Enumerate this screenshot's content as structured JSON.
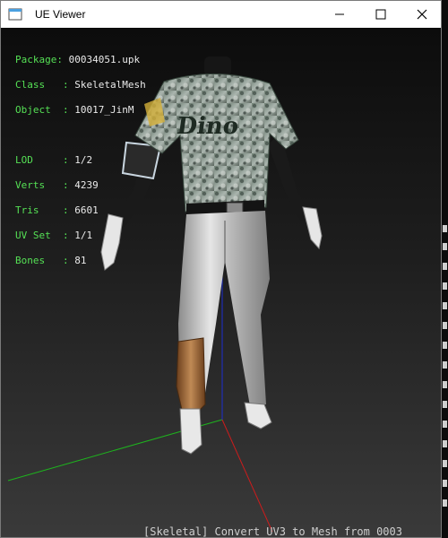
{
  "window": {
    "title": "UE Viewer",
    "controls": {
      "minimize": "—",
      "maximize": "☐",
      "close": "✕"
    }
  },
  "overlay": {
    "package": {
      "label": "Package: ",
      "value": "00034051.upk"
    },
    "class": {
      "label": "Class   : ",
      "value": "SkeletalMesh"
    },
    "object": {
      "label": "Object  : ",
      "value": "10017_JinM"
    },
    "lod": {
      "label": "LOD     : ",
      "value": "1/2"
    },
    "verts": {
      "label": "Verts   : ",
      "value": "4239"
    },
    "tris": {
      "label": "Tris    : ",
      "value": "6601"
    },
    "uvset": {
      "label": "UV Set  : ",
      "value": "1/1"
    },
    "bones": {
      "label": "Bones   : ",
      "value": "81"
    }
  },
  "model": {
    "jersey_text": "Dino"
  },
  "console": {
    "bottom_text": "[Skeletal] Convert UV3 to Mesh from 0003"
  },
  "colors": {
    "label_green": "#55e055",
    "axis_x": "#cc1c1c",
    "axis_y": "#1eb31e",
    "axis_z": "#1c2ed0"
  }
}
